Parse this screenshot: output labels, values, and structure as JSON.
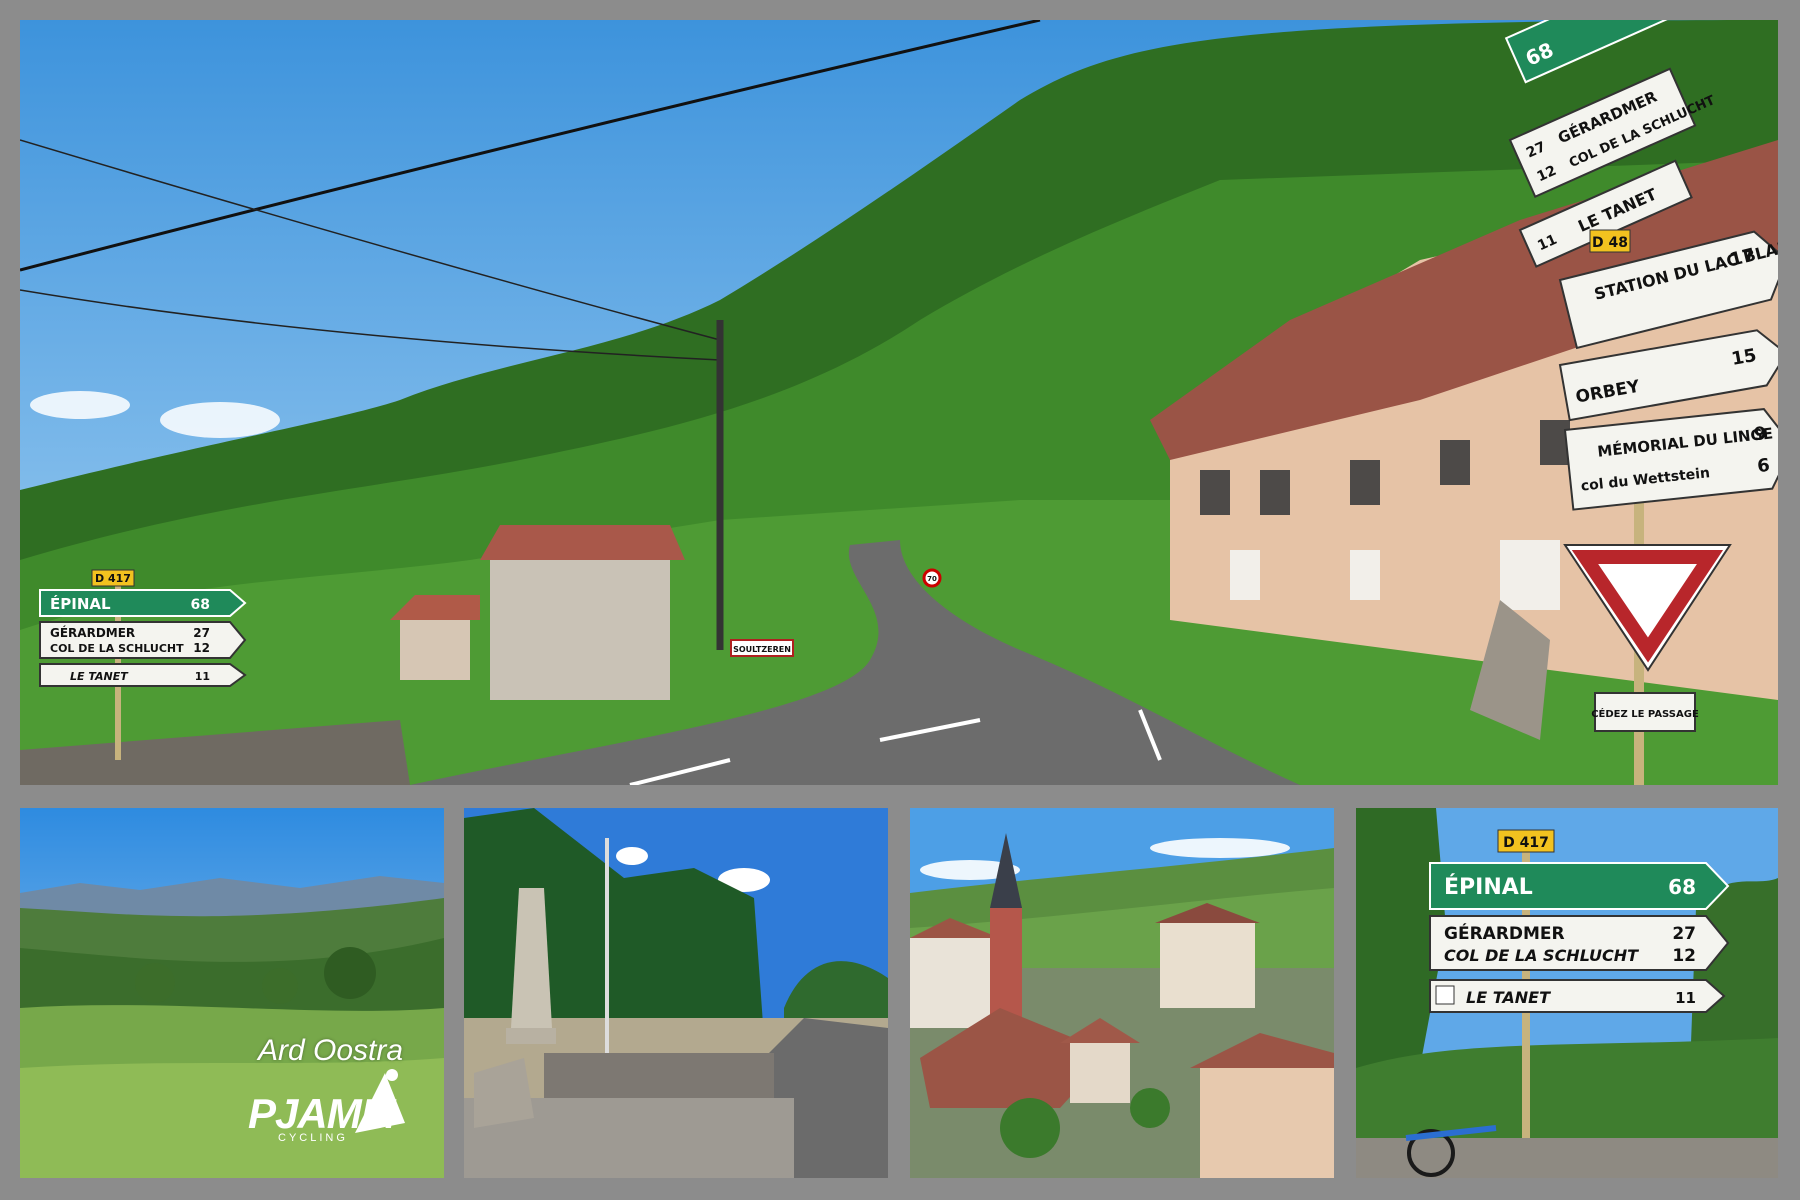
{
  "collage": {
    "background_color": "#8c8c8c",
    "main_photo": {
      "description_free": true,
      "signs_left": {
        "road_number": "D 417",
        "rows": [
          {
            "name": "ÉPINAL",
            "km": "68",
            "color": "#1f8a5a"
          },
          {
            "name": "GÉRARDMER",
            "km": "27"
          },
          {
            "name": "COL DE LA SCHLUCHT",
            "km": "12"
          },
          {
            "name": "LE TANET",
            "km": "11"
          }
        ]
      },
      "signs_right": {
        "rows": [
          {
            "name": "68",
            "color": "#1f8a5a"
          },
          {
            "name": "GÉRARDMER",
            "km": "27"
          },
          {
            "name": "COL DE LA SCHLUCHT",
            "km": "12"
          },
          {
            "name": "LE TANET",
            "km": "11"
          },
          {
            "road_number": "D 48"
          },
          {
            "name": "STATION DU LAC BLANC",
            "km": "17"
          },
          {
            "name": "ORBEY",
            "km": "15"
          },
          {
            "name": "MÉMORIAL DU LINGE",
            "km": "9"
          },
          {
            "name": "col du Wettstein",
            "km": "6"
          }
        ],
        "yield_sign": "CÉDEZ LE PASSAGE"
      },
      "town_sign": "SOULTZEREN",
      "speed_sign": "70"
    },
    "thumb_1": {
      "watermark": {
        "name": "Ard Oostra",
        "logo": "PJAMM",
        "logo_sub": "CYCLING"
      }
    },
    "thumb_4": {
      "road_number": "D 417",
      "rows": [
        {
          "name": "ÉPINAL",
          "km": "68"
        },
        {
          "name": "GÉRARDMER",
          "km": "27"
        },
        {
          "name": "COL DE LA SCHLUCHT",
          "km": "12"
        },
        {
          "name": "LE TANET",
          "km": "11"
        }
      ]
    }
  }
}
